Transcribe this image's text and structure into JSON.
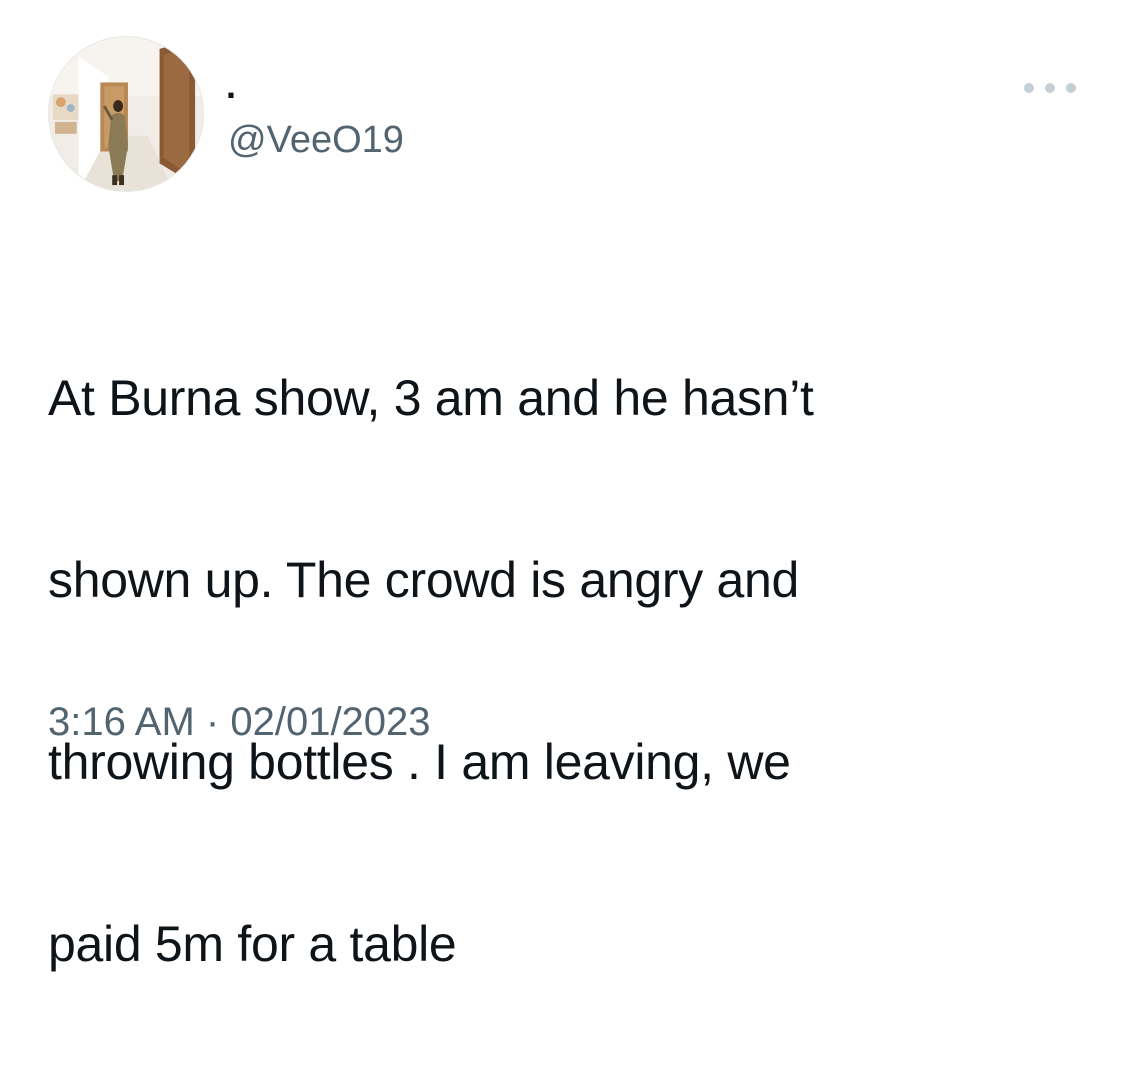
{
  "tweet": {
    "author": {
      "display_name": ".",
      "handle": "@VeeO19",
      "avatar_icon": "profile-photo"
    },
    "more_icon": "more-horizontal-icon",
    "text_lines": [
      "At Burna show, 3 am and he hasn’t",
      "shown up. The crowd is angry and",
      "throwing bottles . I am leaving, we",
      "paid 5m for a table"
    ],
    "time": "3:16 AM",
    "separator": "·",
    "date": "02/01/2023"
  },
  "colors": {
    "text_primary": "#0f1419",
    "text_secondary": "#536471",
    "dots": "#c4cfd6",
    "background": "#ffffff"
  }
}
